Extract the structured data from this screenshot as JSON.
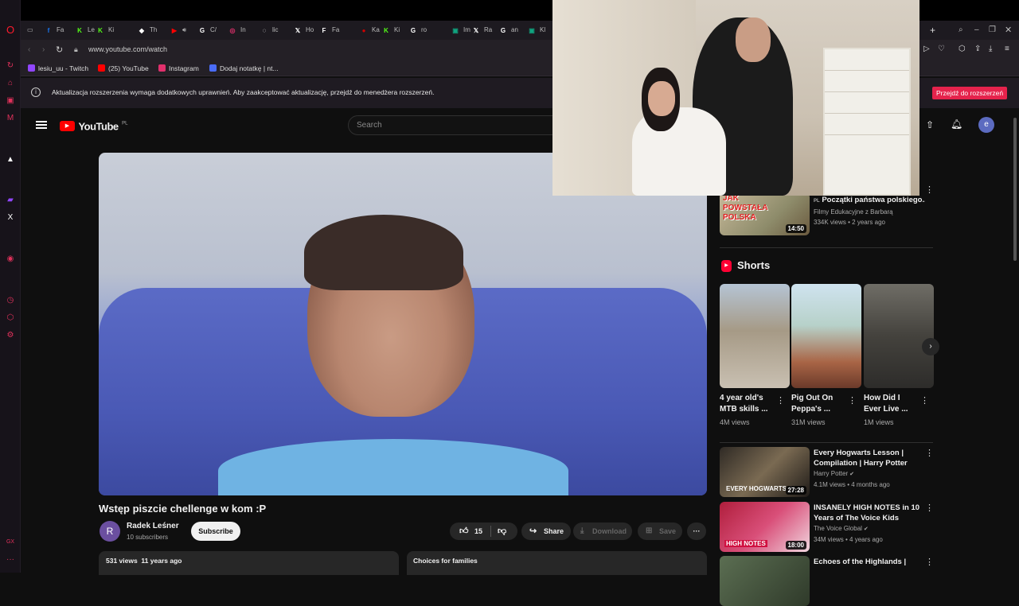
{
  "browser": {
    "tabs": [
      {
        "label": "Fa",
        "icon": "facebook-icon",
        "color": "#1877f2",
        "glyph": "f"
      },
      {
        "label": "Le",
        "icon": "kick-icon",
        "color": "#53fc18",
        "glyph": "K"
      },
      {
        "label": "Ki",
        "icon": "kick-icon",
        "color": "#53fc18",
        "glyph": "K"
      },
      {
        "label": "Th",
        "icon": "diamond-icon",
        "color": "#ffffff",
        "glyph": "◆"
      },
      {
        "label": "",
        "icon": "youtube-icon",
        "color": "#ff0000",
        "glyph": "▶"
      },
      {
        "label": "C/",
        "icon": "chatgpt-icon",
        "color": "#ffffff",
        "glyph": "G"
      },
      {
        "label": "In",
        "icon": "instagram-icon",
        "color": "#e1306c",
        "glyph": "◎"
      },
      {
        "label": "lic",
        "icon": "openai-icon",
        "color": "#ffffff",
        "glyph": "◌"
      },
      {
        "label": "Ho",
        "icon": "x-icon",
        "color": "#ffffff",
        "glyph": "𝕏"
      },
      {
        "label": "Fa",
        "icon": "document-icon",
        "color": "#ffffff",
        "glyph": "F"
      },
      {
        "label": "Ka",
        "icon": "record-icon",
        "color": "#d00000",
        "glyph": "●"
      },
      {
        "label": "Ki",
        "icon": "kick-icon",
        "color": "#53fc18",
        "glyph": "K"
      },
      {
        "label": "ro",
        "icon": "google-icon",
        "color": "#ffffff",
        "glyph": "G"
      },
      {
        "label": "Im",
        "icon": "image-icon",
        "color": "#10a37f",
        "glyph": "▣"
      },
      {
        "label": "Ra",
        "icon": "x-icon",
        "color": "#ffffff",
        "glyph": "𝕏"
      },
      {
        "label": "an",
        "icon": "google-icon",
        "color": "#ffffff",
        "glyph": "G"
      },
      {
        "label": "Kl",
        "icon": "image-icon",
        "color": "#10a37f",
        "glyph": "▣"
      }
    ],
    "url": "www.youtube.com/watch",
    "bookmarks": [
      {
        "label": "lesiu_uu - Twitch",
        "icon": "twitch-icon",
        "color": "#9146ff"
      },
      {
        "label": "(25) YouTube",
        "icon": "youtube-icon",
        "color": "#ff0000"
      },
      {
        "label": "Instagram",
        "icon": "instagram-icon",
        "color": "#e1306c"
      },
      {
        "label": "Dodaj notatkę | nt...",
        "icon": "notion-icon",
        "color": "#4a6cf7"
      }
    ],
    "extension_notice": "Aktualizacja rozszerzenia wymaga dodatkowych uprawnień. Aby zaakceptować aktualizację, przejdź do menedżera rozszerzeń.",
    "extension_button": "Przejdź do rozszerzeń"
  },
  "youtube": {
    "logo_text": "YouTube",
    "logo_region": "PL",
    "search_placeholder": "Search",
    "avatar_letter": "e",
    "video": {
      "title": "Wstęp piszcie chellenge w kom :P",
      "channel": "Radek Leśner",
      "channel_initial": "R",
      "subscribers": "10 subscribers",
      "subscribe_label": "Subscribe",
      "likes": "15",
      "share_label": "Share",
      "download_label": "Download",
      "save_label": "Save",
      "views_date": "531 views  11 years ago",
      "sidebar_chip": "Choices for families"
    },
    "top_video": {
      "title": "Początki państwa polskiego...",
      "prefix": "PL",
      "channel": "Filmy Edukacyjne z Barbarą",
      "meta": "334K views • 2 years ago",
      "duration": "14:50",
      "thumb_text": "JAK POWSTAŁA POLSKA"
    },
    "shorts_title": "Shorts",
    "shorts": [
      {
        "title": "4 year old's MTB skills ...",
        "views": "4M views"
      },
      {
        "title": "Pig Out On Peppa's ...",
        "views": "31M views"
      },
      {
        "title": "How Did I Ever Live ...",
        "views": "1M views"
      }
    ],
    "recommendations": [
      {
        "title": "Every Hogwarts Lesson | Compilation | Harry Potter",
        "channel": "Harry Potter",
        "meta": "4.1M views • 4 months ago",
        "duration": "27:28",
        "thumb_text": "EVERY HOGWARTS CL"
      },
      {
        "title": "INSANELY HIGH NOTES in 10 Years of The Voice Kids",
        "channel": "The Voice Global",
        "meta": "34M views • 4 years ago",
        "duration": "18:00",
        "thumb_text": "HIGH NOTES"
      },
      {
        "title": "Echoes of the Highlands |",
        "channel": "",
        "meta": "",
        "duration": "",
        "thumb_text": ""
      }
    ]
  },
  "colors": {
    "accent": "#ff0033",
    "extension_button_bg": "#e5234c",
    "avatar_bg": "#5c6bc0"
  }
}
